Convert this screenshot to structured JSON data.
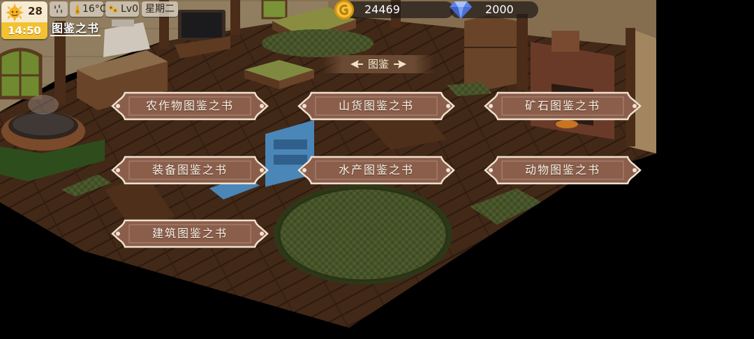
{
  "hud": {
    "day": "28",
    "time": "14:50",
    "temperature": "16°C",
    "level": "Lv0",
    "weekday": "星期二",
    "weather_icon": "rain-icon",
    "sun_icon": "sun-face-icon"
  },
  "screen": {
    "title": "图鉴之书"
  },
  "currency": {
    "gold": "24469",
    "gems": "2000"
  },
  "banner": {
    "label": "图鉴"
  },
  "books": [
    {
      "label": "农作物图鉴之书"
    },
    {
      "label": "山货图鉴之书"
    },
    {
      "label": "矿石图鉴之书"
    },
    {
      "label": "装备图鉴之书"
    },
    {
      "label": "水产图鉴之书"
    },
    {
      "label": "动物图鉴之书"
    },
    {
      "label": "建筑图鉴之书"
    }
  ],
  "colors": {
    "button_fill": "#8b5e4c",
    "button_border": "#f0e2cf",
    "time_bar": "#f3c233",
    "floor": "#5a3620",
    "rug": "#3e4a24"
  }
}
